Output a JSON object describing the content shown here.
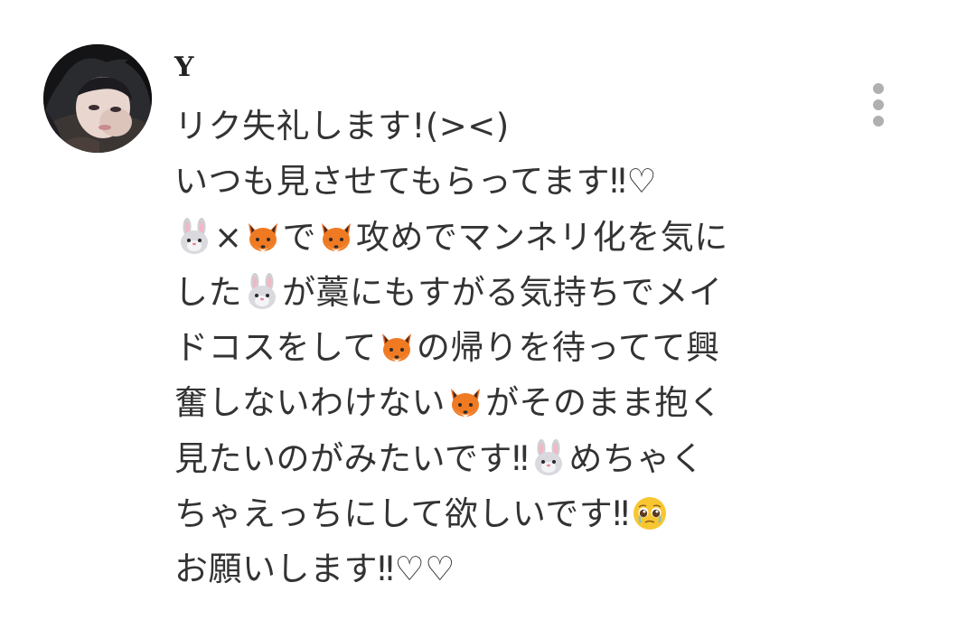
{
  "comment": {
    "username": "Y",
    "avatar_icon": "user-avatar-photo",
    "menu_icon": "vertical-ellipsis-icon",
    "lines": [
      [
        "リク失礼します!(><)"
      ],
      [
        "いつも見させてもらってます‼♡"
      ],
      [
        {
          "emoji": "rabbit"
        },
        "×",
        {
          "emoji": "fox"
        },
        "で",
        {
          "emoji": "fox"
        },
        "攻めでマンネリ化を気に"
      ],
      [
        "した",
        {
          "emoji": "rabbit"
        },
        "が藁にもすがる気持ちでメイ"
      ],
      [
        "ドコスをして",
        {
          "emoji": "fox"
        },
        "の帰りを待ってて興"
      ],
      [
        "奮しないわけない",
        {
          "emoji": "fox"
        },
        "がそのまま抱く"
      ],
      [
        "見たいのがみたいです‼",
        {
          "emoji": "rabbit"
        },
        "めちゃく"
      ],
      [
        "ちゃえっちにして欲しいです‼",
        {
          "emoji": "pleading-face"
        }
      ],
      [
        "お願いします‼♡♡"
      ]
    ]
  },
  "colors": {
    "text": "#333333",
    "username": "#222222",
    "menu_dots": "#b0b0b0",
    "background": "#ffffff"
  }
}
